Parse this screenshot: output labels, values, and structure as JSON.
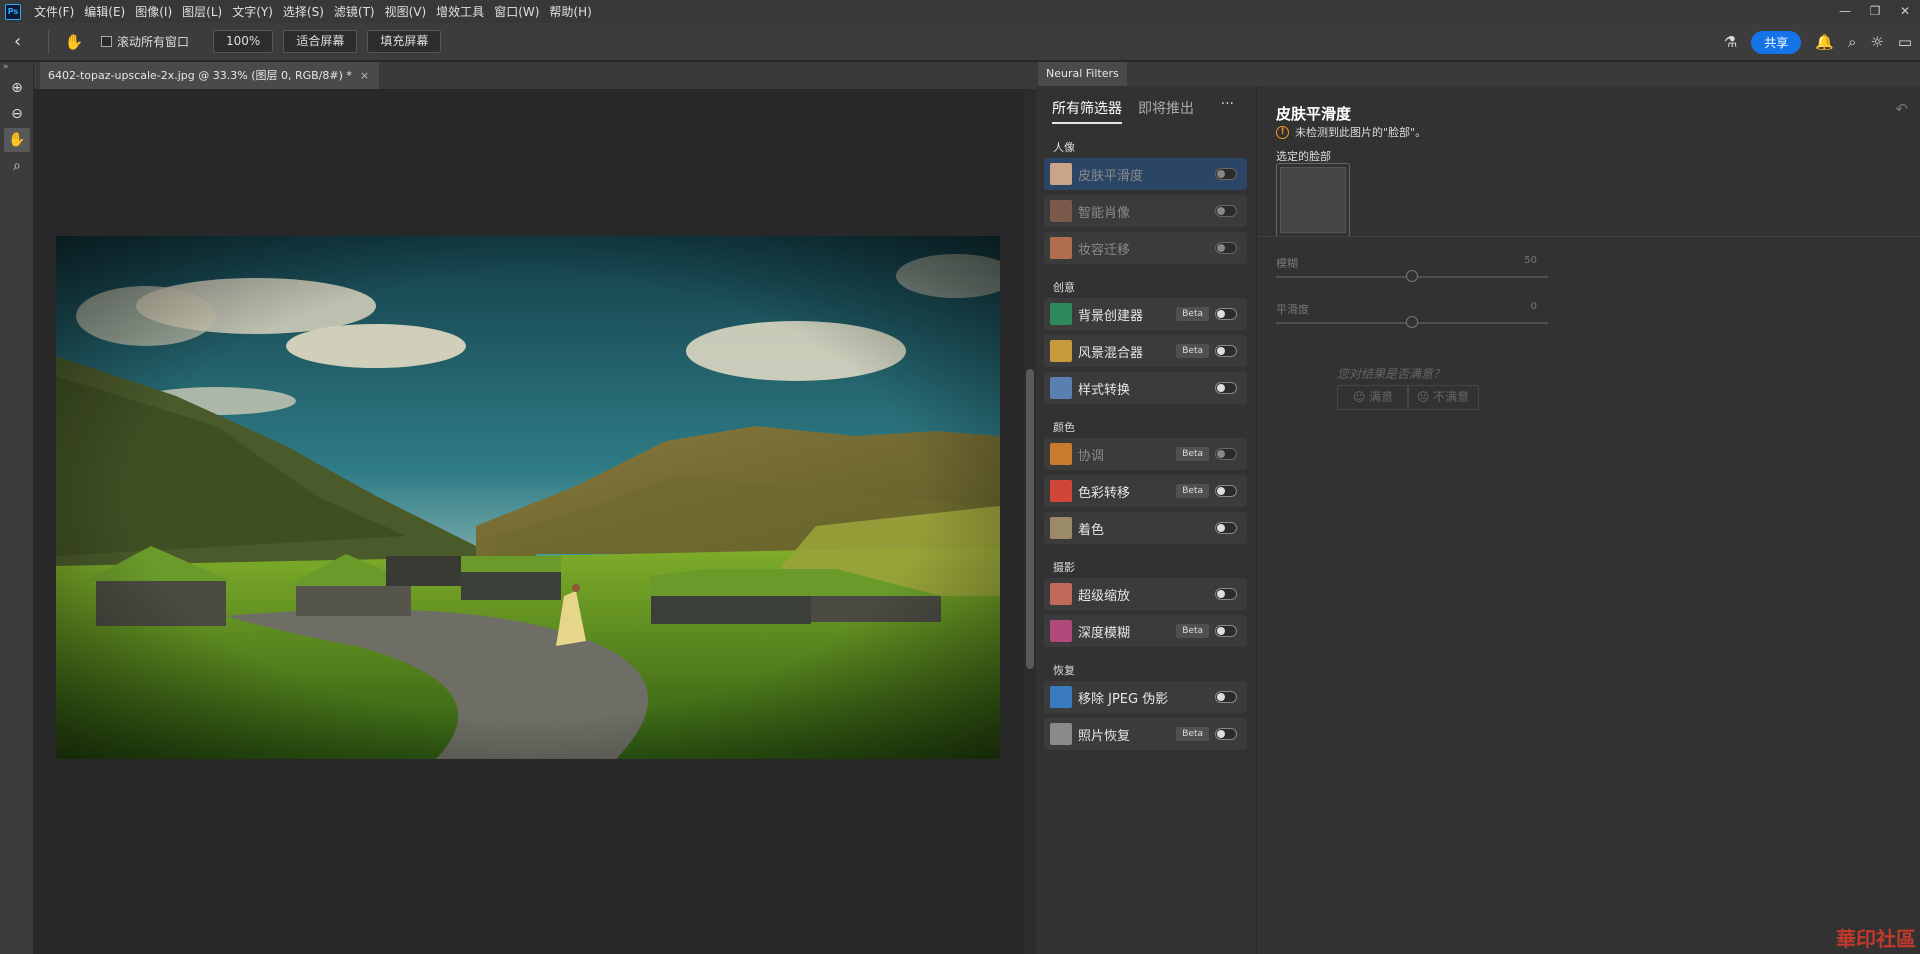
{
  "app": {
    "logo": "Ps"
  },
  "menu": [
    "文件(F)",
    "编辑(E)",
    "图像(I)",
    "图层(L)",
    "文字(Y)",
    "选择(S)",
    "滤镜(T)",
    "视图(V)",
    "增效工具",
    "窗口(W)",
    "帮助(H)"
  ],
  "window_controls": {
    "minimize": "—",
    "restore": "❐",
    "close": "✕"
  },
  "options": {
    "scroll_all_windows": "滚动所有窗口",
    "scroll_all_checked": false,
    "zoom_value": "100%",
    "fit_screen": "适合屏幕",
    "fill_screen": "填充屏幕",
    "share": "共享"
  },
  "document": {
    "tab_title": "6402-topaz-upscale-2x.jpg @ 33.3% (图层 0, RGB/8#) *",
    "close": "×"
  },
  "neural_filters": {
    "panel_tab": "Neural Filters",
    "tabs": [
      "所有筛选器",
      "即将推出"
    ],
    "more": "···",
    "categories": [
      {
        "name": "人像",
        "items": [
          {
            "label": "皮肤平滑度",
            "beta": false,
            "enabled": false,
            "selected": true,
            "dim": true,
            "color": "#c9a489"
          },
          {
            "label": "智能肖像",
            "beta": false,
            "enabled": false,
            "selected": false,
            "dim": true,
            "color": "#7a5a4a"
          },
          {
            "label": "妆容迁移",
            "beta": false,
            "enabled": false,
            "selected": false,
            "dim": true,
            "color": "#b06e4e"
          }
        ]
      },
      {
        "name": "创意",
        "items": [
          {
            "label": "背景创建器",
            "beta": true,
            "enabled": false,
            "selected": false,
            "dim": false,
            "color": "#2e8a5a"
          },
          {
            "label": "风景混合器",
            "beta": true,
            "enabled": false,
            "selected": false,
            "dim": false,
            "color": "#c79a3c"
          },
          {
            "label": "样式转换",
            "beta": false,
            "enabled": false,
            "selected": false,
            "dim": false,
            "color": "#5a7fb0"
          }
        ]
      },
      {
        "name": "颜色",
        "items": [
          {
            "label": "协调",
            "beta": true,
            "enabled": false,
            "selected": false,
            "dim": true,
            "color": "#c97a2a"
          },
          {
            "label": "色彩转移",
            "beta": true,
            "enabled": false,
            "selected": false,
            "dim": false,
            "color": "#d0473a"
          },
          {
            "label": "着色",
            "beta": false,
            "enabled": false,
            "selected": false,
            "dim": false,
            "color": "#9a8a6a"
          }
        ]
      },
      {
        "name": "摄影",
        "items": [
          {
            "label": "超级缩放",
            "beta": false,
            "enabled": false,
            "selected": false,
            "dim": false,
            "color": "#c06a5a"
          },
          {
            "label": "深度模糊",
            "beta": true,
            "enabled": false,
            "selected": false,
            "dim": false,
            "color": "#b04a7a"
          }
        ]
      },
      {
        "name": "恢复",
        "items": [
          {
            "label": "移除 JPEG 伪影",
            "beta": false,
            "enabled": false,
            "selected": false,
            "dim": false,
            "color": "#3a7ac0"
          },
          {
            "label": "照片恢复",
            "beta": true,
            "enabled": false,
            "selected": false,
            "dim": false,
            "color": "#8a8a8a"
          }
        ]
      }
    ],
    "beta_label": "Beta",
    "detail": {
      "title": "皮肤平滑度",
      "warning": "未检测到此图片的\"脸部\"。",
      "selected_face_label": "选定的脸部",
      "sliders": [
        {
          "label": "模糊",
          "value": 50,
          "max": 100
        },
        {
          "label": "平滑度",
          "value": 0,
          "min": -50,
          "max": 50
        }
      ],
      "feedback_question": "您对结果是否满意？",
      "satisfied": "满意",
      "unsatisfied": "不满意"
    }
  },
  "watermark": "華印社區"
}
